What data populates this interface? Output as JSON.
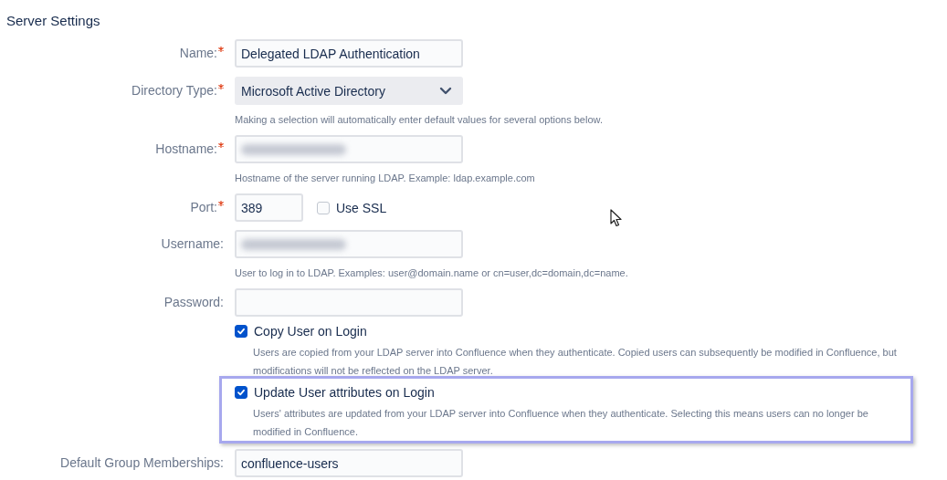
{
  "section": {
    "title": "Server Settings"
  },
  "rows": [
    {
      "kind": "text",
      "label": "Name:",
      "required": true,
      "value": "Delegated LDAP Authentication"
    },
    {
      "kind": "select",
      "label": "Directory Type:",
      "required": true,
      "value": "Microsoft Active Directory",
      "hint": "Making a selection will automatically enter default values for several options below."
    },
    {
      "kind": "text",
      "label": "Hostname:",
      "required": true,
      "redacted": true,
      "hint": "Hostname of the server running LDAP. Example: ldap.example.com"
    },
    {
      "kind": "port",
      "label": "Port:",
      "required": true,
      "value": "389",
      "option": {
        "label": "Use SSL",
        "checked": false
      }
    },
    {
      "kind": "text",
      "label": "Username:",
      "redacted": true,
      "hint": "User to log in to LDAP. Examples: user@domain.name or cn=user,dc=domain,dc=name."
    },
    {
      "kind": "text",
      "label": "Password:"
    },
    {
      "kind": "checkbox",
      "label": "Copy User on Login",
      "checked": true,
      "description": "Users are copied from your LDAP server into Confluence when they authenticate. Copied users can subsequently be modified in Confluence, but modifications will not be reflected on the LDAP server."
    },
    {
      "kind": "checkbox",
      "label": "Update User attributes on Login",
      "checked": true,
      "highlighted": true,
      "description": "Users' attributes are updated from your LDAP server into Confluence when they authenticate. Selecting this means users can no longer be modified in Confluence."
    },
    {
      "kind": "text",
      "label": "Default Group Memberships:",
      "value": "confluence-users"
    }
  ]
}
